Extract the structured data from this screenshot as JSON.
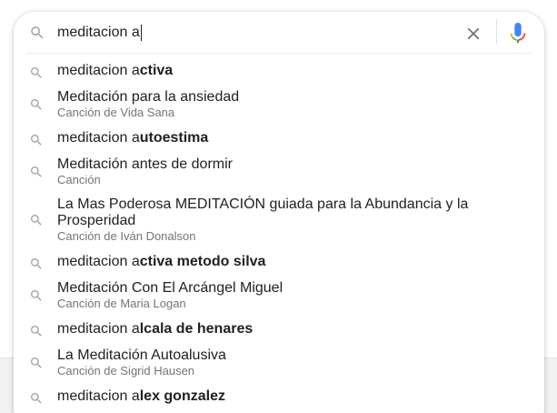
{
  "search": {
    "value": "meditacion a",
    "clear_icon": "close-icon",
    "mic_icon": "microphone-icon",
    "search_icon": "search-icon",
    "mic_colors": [
      "#4285f4",
      "#ea4335",
      "#fbbc05",
      "#34a853"
    ]
  },
  "suggestions": [
    {
      "prefix": "meditacion a",
      "bold": "ctiva",
      "text": "",
      "sub": ""
    },
    {
      "prefix": "",
      "bold": "",
      "text": "Meditación para la ansiedad",
      "sub": "Canción de Vida Sana"
    },
    {
      "prefix": "meditacion a",
      "bold": "utoestima",
      "text": "",
      "sub": ""
    },
    {
      "prefix": "",
      "bold": "",
      "text": "Meditación antes de dormir",
      "sub": "Canción"
    },
    {
      "prefix": "",
      "bold": "",
      "text": "La Mas Poderosa MEDITACIÓN guiada para la Abundancia y la Prosperidad",
      "sub": "Canción de Iván Donalson"
    },
    {
      "prefix": "meditacion a",
      "bold": "ctiva metodo silva",
      "text": "",
      "sub": ""
    },
    {
      "prefix": "",
      "bold": "",
      "text": "Meditación Con El Arcángel Miguel",
      "sub": "Canción de Maria Logan"
    },
    {
      "prefix": "meditacion a",
      "bold": "lcala de henares",
      "text": "",
      "sub": ""
    },
    {
      "prefix": "",
      "bold": "",
      "text": "La Meditación Autoalusiva",
      "sub": "Canción de Sigrid Hausen"
    },
    {
      "prefix": "meditacion a",
      "bold": "lex gonzalez",
      "text": "",
      "sub": ""
    }
  ]
}
